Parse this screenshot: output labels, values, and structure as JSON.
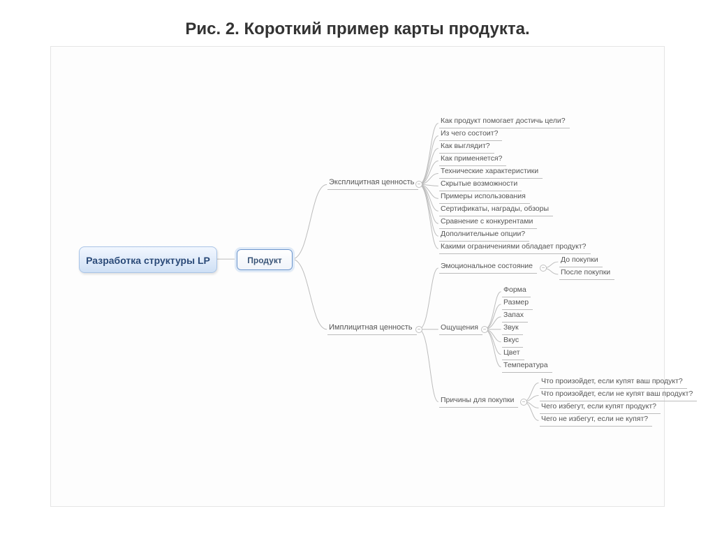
{
  "title": "Рис. 2. Короткий пример карты продукта.",
  "root": "Разработка структуры LP",
  "product": "Продукт",
  "explicit": {
    "label": "Эксплицитная ценность",
    "items": [
      "Как продукт помогает достичь цели?",
      "Из чего состоит?",
      "Как выглядит?",
      "Как применяется?",
      "Технические характеристики",
      "Скрытые возможности",
      "Примеры использования",
      "Сертификаты, награды, обзоры",
      "Сравнение с конкурентами",
      "Дополнительные опции?",
      "Какими ограничениями обладает продукт?"
    ]
  },
  "implicit": {
    "label": "Имплицитная ценность",
    "emotional": {
      "label": "Эмоциональное состояние",
      "items": [
        "До покупки",
        "После покупки"
      ]
    },
    "sense": {
      "label": "Ощущения",
      "items": [
        "Форма",
        "Размер",
        "Запах",
        "Звук",
        "Вкус",
        "Цвет",
        "Температура"
      ]
    },
    "reasons": {
      "label": "Причины для покупки",
      "items": [
        "Что произойдет, если купят ваш продукт?",
        "Что произойдет, если не купят ваш продукт?",
        "Чего избегут, если купят продукт?",
        "Чего не избегут, если не купят?"
      ]
    }
  }
}
